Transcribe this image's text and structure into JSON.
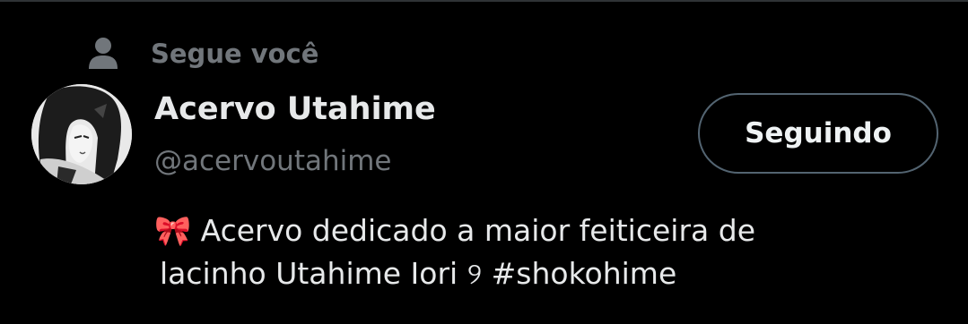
{
  "follows_you": {
    "icon": "person-icon",
    "text": "Segue você"
  },
  "user": {
    "avatar_icon": "avatar-image",
    "display_name": "Acervo Utahime",
    "handle": "@acervoutahime"
  },
  "follow_button": {
    "label": "Seguindo"
  },
  "bio": {
    "line1": "🎀 Acervo dedicado a maior feiticeira de",
    "line2_text": "lacinho Utahime Iori ",
    "line2_symbol": "୨",
    "hashtag": "#shokohime"
  },
  "colors": {
    "background": "#000000",
    "primary_text": "#e7e9ea",
    "secondary_text": "#71767b",
    "button_border": "#536471",
    "divider": "#2f3336"
  }
}
